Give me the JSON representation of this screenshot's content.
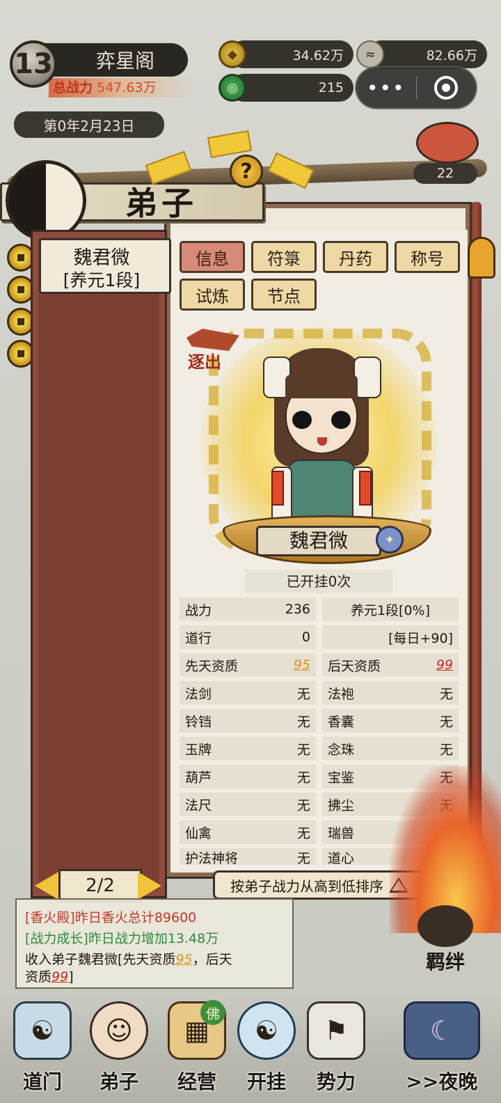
{
  "hud": {
    "level": "13",
    "sect_name": "弈星阁",
    "power_label": "总战力",
    "power_value": "547.63万",
    "date": "第0年2月23日",
    "coins": "34.62万",
    "spirit": "82.66万",
    "jade": "215"
  },
  "panel": {
    "title": "弟子",
    "tabs": [
      "信息",
      "符箓",
      "丹药",
      "称号",
      "试炼",
      "节点"
    ],
    "active_tab": "信息",
    "right_badge_count": "22"
  },
  "disciple_list": {
    "items": [
      {
        "name": "魏君微",
        "rank": "[养元1段]"
      }
    ],
    "page": "2/2"
  },
  "disciple": {
    "expel_label": "逐出",
    "name": "魏君微",
    "afk_text": "已开挂0次",
    "stats": [
      {
        "label": "战力",
        "value": "236"
      },
      {
        "label": "养元1段[0%]",
        "value": ""
      },
      {
        "label": "道行",
        "value": "0"
      },
      {
        "label": "",
        "value": "[每日+90]"
      },
      {
        "label": "先天资质",
        "value": "95"
      },
      {
        "label": "后天资质",
        "value": "99"
      },
      {
        "label": "法剑",
        "value": "无"
      },
      {
        "label": "法袍",
        "value": "无"
      },
      {
        "label": "铃铛",
        "value": "无"
      },
      {
        "label": "香囊",
        "value": "无"
      },
      {
        "label": "玉牌",
        "value": "无"
      },
      {
        "label": "念珠",
        "value": "无"
      },
      {
        "label": "葫芦",
        "value": "无"
      },
      {
        "label": "宝鉴",
        "value": "无"
      },
      {
        "label": "法尺",
        "value": "无"
      },
      {
        "label": "拂尘",
        "value": "无"
      },
      {
        "label": "仙禽",
        "value": "无"
      },
      {
        "label": "瑞兽",
        "value": "无"
      },
      {
        "label": "护法神将",
        "value": "无"
      },
      {
        "label": "道心",
        "value": "无"
      }
    ],
    "sort_label": "按弟子战力从高到低排序"
  },
  "log": {
    "line1": "[香火殿]昨日香火总计89600",
    "line2": "[战力成长]昨日战力增加13.48万",
    "line3_prefix": "收入弟子魏君微[先天资质",
    "line3_q1": "95",
    "line3_mid": "，后天",
    "line4_prefix": "资质",
    "line4_q2": "99",
    "line4_suffix": "]"
  },
  "fate_label": "羁绊",
  "nav": {
    "items": [
      "道门",
      "弟子",
      "经营",
      "开挂",
      "势力",
      ">>夜晚"
    ],
    "buddha_badge": "佛"
  },
  "colors": {
    "accent_gold": "#f0c43a",
    "active_tab": "#d88a78",
    "list_bg": "#7c3f33",
    "log_red": "#c0392b",
    "log_green": "#2e8a3c"
  }
}
